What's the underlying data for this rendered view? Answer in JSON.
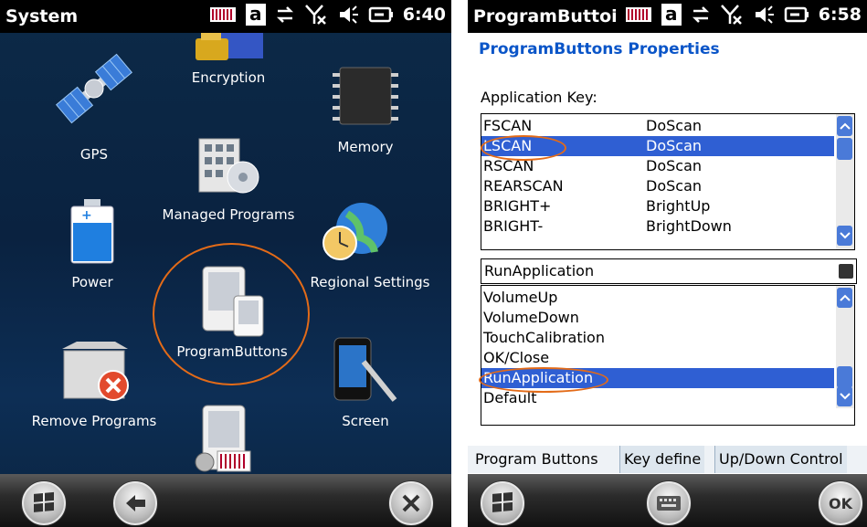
{
  "left": {
    "title": "System",
    "keyboard_letter": "a",
    "time": "6:40",
    "icons": [
      {
        "label": "GPS",
        "icon": "satellite-icon"
      },
      {
        "label": "Encryption",
        "icon": "lock-icon"
      },
      {
        "label": "Memory",
        "icon": "chip-icon"
      },
      {
        "label": "Managed Programs",
        "icon": "building-disc-icon"
      },
      {
        "label": "Power",
        "icon": "battery-icon"
      },
      {
        "label": "ProgramButtons",
        "icon": "device-icon"
      },
      {
        "label": "Regional Settings",
        "icon": "globe-clock-icon"
      },
      {
        "label": "Remove Programs",
        "icon": "box-remove-icon"
      },
      {
        "label": "Screen",
        "icon": "stylus-device-icon"
      },
      {
        "label": "",
        "icon": "barcode-settings-icon"
      }
    ],
    "highlight_color": "#e36b18"
  },
  "right": {
    "title": "ProgramButtoi",
    "keyboard_letter": "a",
    "time": "6:58",
    "props_title": "ProgramButtons Properties",
    "app_key_label": "Application Key:",
    "app_keys": [
      {
        "key": "FSCAN",
        "action": "DoScan"
      },
      {
        "key": "LSCAN",
        "action": "DoScan"
      },
      {
        "key": "RSCAN",
        "action": "DoScan"
      },
      {
        "key": "REARSCAN",
        "action": "DoScan"
      },
      {
        "key": "BRIGHT+",
        "action": "BrightUp"
      },
      {
        "key": "BRIGHT-",
        "action": "BrightDown"
      }
    ],
    "selected_key": "LSCAN",
    "combo_value": "RunApplication",
    "actions": [
      "VolumeUp",
      "VolumeDown",
      "TouchCalibration",
      "OK/Close",
      "RunApplication",
      "Default"
    ],
    "selected_action": "RunApplication",
    "tabs": [
      "Program Buttons",
      "Key define",
      "Up/Down Control"
    ],
    "ok_label": "OK",
    "selection_color": "#2f5fd3"
  }
}
